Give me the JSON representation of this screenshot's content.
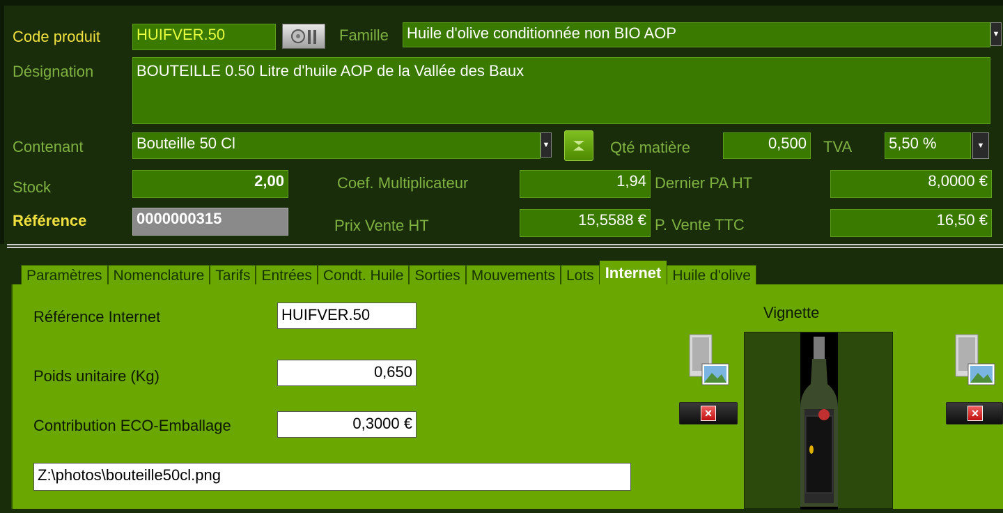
{
  "header": {
    "code_label": "Code produit",
    "code_value": "HUIFVER.50",
    "famille_label": "Famille",
    "famille_value": "Huile d'olive conditionnée non BIO AOP",
    "designation_label": "Désignation",
    "designation_value": "BOUTEILLE 0.50 Litre d'huile AOP de la Vallée des Baux",
    "contenant_label": "Contenant",
    "contenant_value": "Bouteille 50 Cl",
    "qte_label": "Qté matière",
    "qte_value": "0,500",
    "tva_label": "TVA",
    "tva_value": "5,50 %",
    "stock_label": "Stock",
    "stock_value": "2,00",
    "coef_label": "Coef. Multiplicateur",
    "coef_value": "1,94",
    "dernier_label": "Dernier PA HT",
    "dernier_value": "8,0000 €",
    "reference_label": "Référence",
    "reference_value": "0000000315",
    "prix_ht_label": "Prix Vente HT",
    "prix_ht_value": "15,5588 €",
    "prix_ttc_label": "P. Vente TTC",
    "prix_ttc_value": "16,50 €"
  },
  "tabs": [
    {
      "label": "Paramètres"
    },
    {
      "label": "Nomenclature"
    },
    {
      "label": "Tarifs"
    },
    {
      "label": "Entrées"
    },
    {
      "label": "Condt. Huile"
    },
    {
      "label": "Sorties"
    },
    {
      "label": "Mouvements"
    },
    {
      "label": "Lots"
    },
    {
      "label": "Internet"
    },
    {
      "label": "Huile d'olive"
    }
  ],
  "internet": {
    "ref_label": "Référence Internet",
    "ref_value": "HUIFVER.50",
    "poids_label": "Poids unitaire (Kg)",
    "poids_value": "0,650",
    "eco_label": "Contribution ECO-Emballage",
    "eco_value": "0,3000 €",
    "path_value": "Z:\\photos\\bouteille50cl.png",
    "vignette_label": "Vignette"
  },
  "colors": {
    "background": "#1a2d0a",
    "field": "#3a7a00",
    "panel": "#6aa700",
    "label_yellow": "#f0e040"
  },
  "icons": [
    "list-icon",
    "clear-icon",
    "image-folder-icon",
    "delete-icon",
    "dropdown-arrow-icon"
  ]
}
